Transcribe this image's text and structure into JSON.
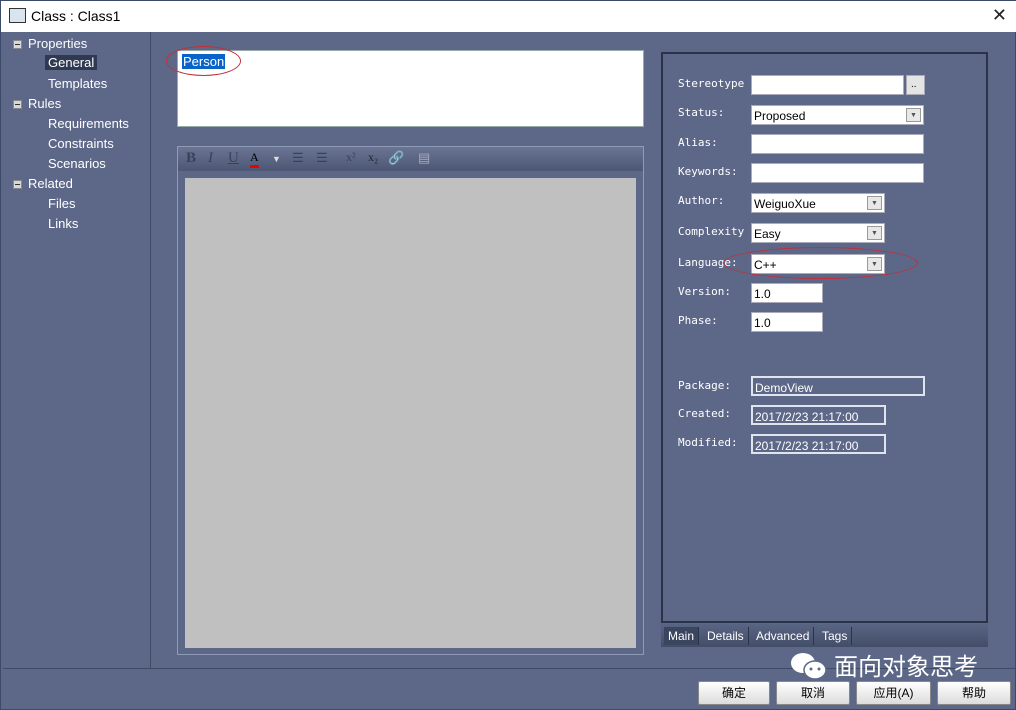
{
  "window": {
    "title": "Class : Class1"
  },
  "sidebar": {
    "groups": [
      {
        "label": "Properties",
        "items": [
          "General",
          "Templates"
        ]
      },
      {
        "label": "Rules",
        "items": [
          "Requirements",
          "Constraints",
          "Scenarios"
        ]
      },
      {
        "label": "Related",
        "items": [
          "Files",
          "Links"
        ]
      }
    ],
    "selected": "General"
  },
  "name": {
    "value": "Person"
  },
  "toolbar": {
    "buttons": [
      "bold",
      "italic",
      "underline",
      "font-color",
      "bullet-list",
      "numbered-list",
      "superscript",
      "subscript",
      "hyperlink",
      "document"
    ]
  },
  "props": {
    "stereotype": {
      "label": "Stereotype",
      "value": "",
      "button": ".."
    },
    "status": {
      "label": "Status:",
      "value": "Proposed"
    },
    "alias": {
      "label": "Alias:",
      "value": ""
    },
    "keywords": {
      "label": "Keywords:",
      "value": ""
    },
    "author": {
      "label": "Author:",
      "value": "WeiguoXue"
    },
    "complexity": {
      "label": "Complexity",
      "value": "Easy"
    },
    "language": {
      "label": "Language:",
      "value": "C++"
    },
    "version": {
      "label": "Version:",
      "value": "1.0"
    },
    "phase": {
      "label": "Phase:",
      "value": "1.0"
    },
    "package": {
      "label": "Package:",
      "value": "DemoView"
    },
    "created": {
      "label": "Created:",
      "value": "2017/2/23 21:17:00"
    },
    "modified": {
      "label": "Modified:",
      "value": "2017/2/23 21:17:00"
    }
  },
  "tabs": [
    "Main",
    "Details",
    "Advanced",
    "Tags"
  ],
  "active_tab": "Main",
  "buttons": {
    "ok": "确定",
    "cancel": "取消",
    "apply": "应用(A)",
    "help": "帮助"
  },
  "watermark": "面向对象思考"
}
